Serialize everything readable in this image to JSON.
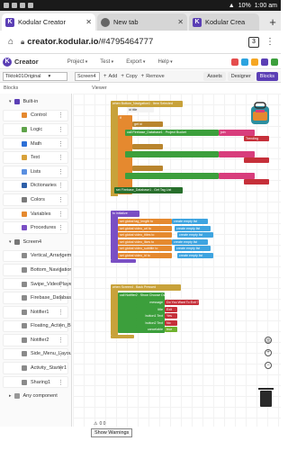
{
  "status_bar": {
    "battery": "10%",
    "time": "1:00 am"
  },
  "browser": {
    "tabs": [
      {
        "title": "Kodular Creator",
        "favicon": "K",
        "active": true
      },
      {
        "title": "New tab",
        "favicon": "globe",
        "active": false
      },
      {
        "title": "Kodular Crea",
        "favicon": "K",
        "active": false
      }
    ],
    "url_host": "creator.kodular.io",
    "url_rest": "/#4795464777",
    "tab_count": "3"
  },
  "app": {
    "name": "Creator",
    "menus": [
      "Project",
      "Test",
      "Export",
      "Help"
    ],
    "icon_colors": [
      "#e54d4d",
      "#2ca3df",
      "#f5a623",
      "#5b3fb5",
      "#3c9f3c"
    ]
  },
  "toolbar": {
    "project": "Tiktok01Original",
    "screen": "Screen4",
    "add": "Add",
    "copy": "Copy",
    "remove": "Remove",
    "assets": "Assets",
    "designer": "Designer",
    "blocks": "Blocks"
  },
  "labels": {
    "blocks": "Blocks",
    "viewer": "Viewer"
  },
  "sidebar": {
    "builtin_header": "Built-in",
    "builtin": [
      {
        "label": "Control",
        "color": "#e5892f"
      },
      {
        "label": "Logic",
        "color": "#5fa34a"
      },
      {
        "label": "Math",
        "color": "#2c6fd6"
      },
      {
        "label": "Text",
        "color": "#d8a13a"
      },
      {
        "label": "Lists",
        "color": "#5a8fe0"
      },
      {
        "label": "Dictionaries",
        "color": "#2d5fa8"
      },
      {
        "label": "Colors",
        "color": "#7a7a7a"
      },
      {
        "label": "Variables",
        "color": "#e5892f"
      },
      {
        "label": "Procedures",
        "color": "#7a4fc4"
      }
    ],
    "screen_header": "Screen4",
    "components": [
      "Vertical_Arrangeme...",
      "Bottom_Navigation1",
      "Swipe_VideoPlayer1",
      "Firebase_Database1",
      "Notifier1",
      "Floating_Action_But...",
      "Notifier2",
      "Side_Menu_Layout1",
      "Activity_Starter1",
      "Sharing1"
    ],
    "any_component": "Any component"
  },
  "workspace": {
    "event1": "when Bottom_Navigation1 . Item Selected",
    "event1_params": "id  title",
    "event1_if": "if",
    "event1_get": "get id",
    "event1_call": "call Firebase_Database1 . Project Bucket",
    "event1_join": "join",
    "event1_text": "Trending",
    "event1_set": "set Firebase_Database1 . Get Tag List",
    "proc": "to initialize",
    "proc_sets": [
      "set global tag_length to",
      "set global video_url to",
      "set global video_titles to",
      "set global video_likes to",
      "set global video_subtitle to",
      "set global video_id to"
    ],
    "proc_value": "create empty list",
    "event3": "when Screen4 . Back Pressed",
    "event3_call": "call Notifier2 . Show Choose Dialog",
    "event3_args": [
      "message",
      "title",
      "button1 Text",
      "button2 Text",
      "cancelable"
    ],
    "event3_values": [
      "Do You Want To Exit ?",
      "Exit",
      "Yes",
      "No",
      "true"
    ],
    "show_warnings": "Show Warnings",
    "warn_counts": "0  0"
  }
}
